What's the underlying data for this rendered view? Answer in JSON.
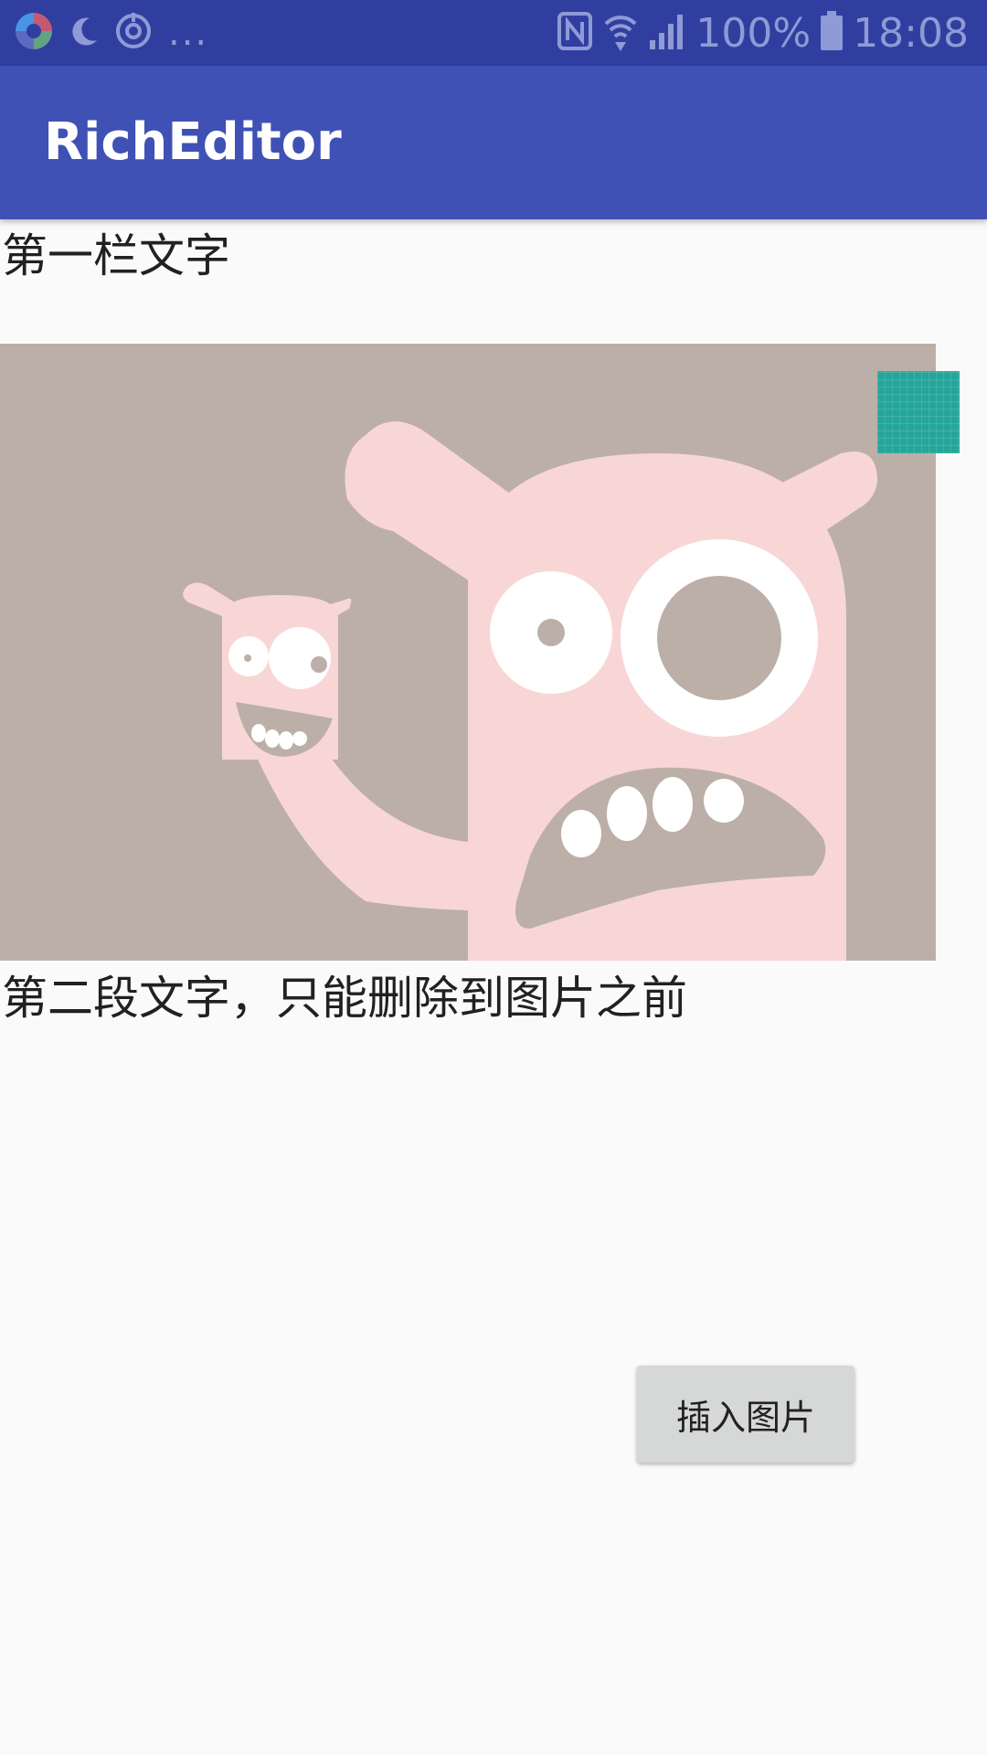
{
  "status_bar": {
    "battery": "100%",
    "time": "18:08",
    "overflow": "...",
    "icons": [
      "app-icon",
      "moon-icon",
      "sync-icon",
      "nfc-icon",
      "wifi-icon",
      "signal-icon",
      "battery-icon"
    ]
  },
  "app_bar": {
    "title": "RichEditor"
  },
  "editor": {
    "paragraph_1": "第一栏文字",
    "image": {
      "description_icon": "monster-illustration",
      "colors": {
        "background": "#bcafa8",
        "body": "#f9d6d6",
        "eye": "#ffffff"
      }
    },
    "paragraph_2": "第二段文字，只能删除到图片之前"
  },
  "insert_button": {
    "label": "插入图片"
  },
  "colors": {
    "status_bar": "#303f9f",
    "app_bar": "#3f51b5",
    "accent": "#26a69a",
    "background": "#fafafa"
  }
}
